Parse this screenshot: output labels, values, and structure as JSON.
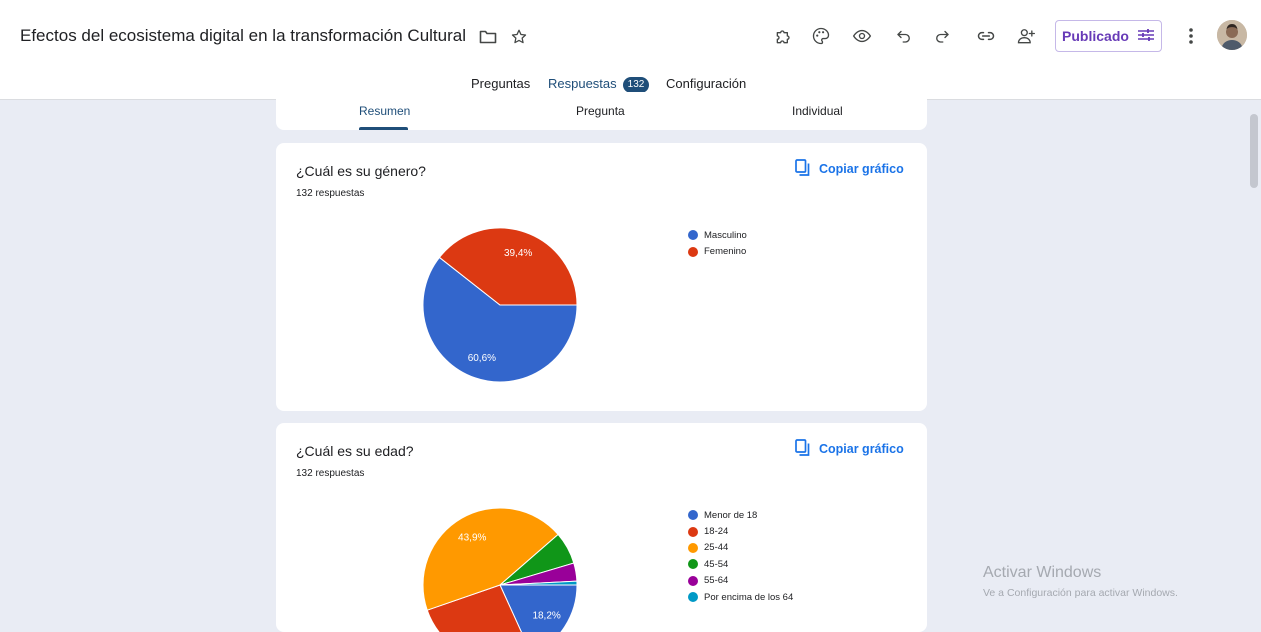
{
  "header": {
    "title": "Efectos del ecosistema digital en la transformación Cultural",
    "icons": [
      "folder-icon",
      "star-icon",
      "addon-icon",
      "palette-icon",
      "preview-icon",
      "undo-icon",
      "redo-icon",
      "link-icon",
      "add-collaborator-icon",
      "more-vert-icon"
    ],
    "publish_label": "Publicado"
  },
  "tabs": [
    {
      "label": "Preguntas"
    },
    {
      "label": "Respuestas",
      "badge": "132"
    },
    {
      "label": "Configuración"
    }
  ],
  "subtabs": [
    {
      "label": "Resumen"
    },
    {
      "label": "Pregunta"
    },
    {
      "label": "Individual"
    }
  ],
  "copy_label": "Copiar gráfico",
  "questions": [
    {
      "title": "¿Cuál es su género?",
      "count": "132 respuestas"
    },
    {
      "title": "¿Cuál es su edad?",
      "count": "132 respuestas"
    }
  ],
  "chart_data": [
    {
      "type": "pie",
      "categories": [
        "Masculino",
        "Femenino"
      ],
      "values": [
        60.6,
        39.4
      ],
      "labels": [
        "60,6%",
        "39,4%"
      ],
      "colors": [
        "#3366cc",
        "#dc3912"
      ],
      "legend": "right"
    },
    {
      "type": "pie",
      "categories": [
        "Menor de 18",
        "18-24",
        "25-44",
        "45-54",
        "55-64",
        "Por encima de los 64"
      ],
      "values": [
        18.2,
        26.5,
        43.9,
        6.8,
        3.8,
        0.8
      ],
      "labels": [
        "18,2%",
        "",
        "43,9%",
        "",
        "",
        ""
      ],
      "colors": [
        "#3366cc",
        "#dc3912",
        "#ff9900",
        "#109618",
        "#990099",
        "#0099c6"
      ],
      "legend": "right"
    }
  ],
  "watermark": {
    "title": "Activar Windows",
    "subtitle": "Ve a Configuración para activar Windows."
  }
}
